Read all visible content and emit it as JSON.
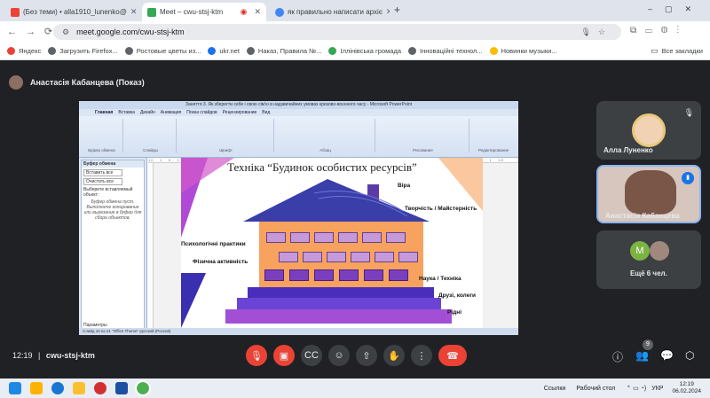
{
  "browser": {
    "tabs": [
      {
        "label": "(Без теми) • alla1910_lunenko@",
        "active": false,
        "color": "#ea4335"
      },
      {
        "label": "Meet – cwu-stsj-ktm",
        "active": true,
        "color": "#34a853"
      },
      {
        "label": "як правильно написати архіє",
        "active": false,
        "color": "#4285f4"
      }
    ],
    "new_tab_symbol": "+",
    "url": "meet.google.com/cwu-stsj-ktm",
    "bookmarks": [
      "Яндекс",
      "Загрузить Firefox...",
      "Ростовые цветы из...",
      "ukr.net",
      "Наказ, Правила №...",
      "Іллінівська громада",
      "Інноваційні технол...",
      "Новинки музыки...",
      "Все закладки"
    ]
  },
  "meet": {
    "presenter_label": "Анастасія Кабанцева (Показ)",
    "meeting_code": "cwu-stsj-ktm",
    "time": "12:19",
    "participants_count": "9",
    "participants": [
      {
        "name": "Алла Луненко"
      },
      {
        "name": "Анастасія Кабанцева"
      }
    ],
    "more_label": "Ещё 6 чел.",
    "avatar_letter": "M"
  },
  "ppt": {
    "window_title": "Заняття 3. Як зберегти себе і свою сім'ю в надзвичайних умовах кризово-воєнного часу - Microsoft PowerPoint",
    "ribbon_tabs": [
      "Главная",
      "Вставка",
      "Дизайн",
      "Анимация",
      "Показ слайдов",
      "Рецензирование",
      "Вид"
    ],
    "ribbon_groups": [
      "Буфер обмена",
      "Слайды",
      "Шрифт",
      "Абзац",
      "Рисование",
      "Редактирование"
    ],
    "clipboard_title": "Буфер обмена",
    "clipboard_btns": [
      "Вставить все",
      "Очистить все"
    ],
    "clipboard_hint": "Выберите вставляемый объект:",
    "clipboard_empty": "Буфер обмена пуст. Выполните копирование или вырезание в буфер для сбора объектов.",
    "params_label": "Параметры",
    "status_text": "Слайд 10 из 21   \"Office Theme\"   русский (Россия)",
    "ruler_text": "10 · 1 · 9 · 1 · 8 · 1 · 7 · 1 · 6 · 1 · 5 · 1 · 4 · 1 · 3 · 1 · 2 · 1 · 1 · 1 · 0 · 1 · 1 · 1 · 2 · 1 · 3 · 1 · 4 · 1 · 5 · 1 · 6 · 1 · 7 · 1 · 8 · 1 · 9 · 1 · 10"
  },
  "slide": {
    "title": "Техніка “Будинок особистих ресурсів”",
    "labels": {
      "chimney": "Віра",
      "roof": "Творчість / Майстерність",
      "psych": "Психологічні практики",
      "physical": "Фізична активність",
      "science": "Наука / Техніка",
      "friends": "Друзі, колеги",
      "family": "Рідні"
    }
  },
  "taskbar": {
    "links_label": "Ссылки",
    "desktop_label": "Рабочий стол",
    "lang": "УКР",
    "time": "12:19",
    "date": "06.02.2024"
  },
  "colors": {
    "meet_bg": "#202124",
    "end_call": "#ea4335",
    "house_wall": "#f7a25f",
    "roof": "#3a3ea8",
    "step_light": "#a24fd6",
    "step_dark": "#4b2dbb"
  }
}
